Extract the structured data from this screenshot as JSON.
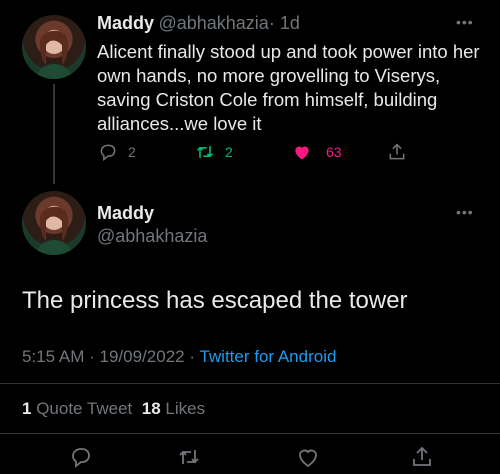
{
  "reply_tweet": {
    "author_name": "Maddy",
    "author_handle": "@abhakhazia",
    "time": "· 1d",
    "text": "Alicent finally stood up and took power into her own hands, no more grovelling to Viserys, saving Criston Cole from himself, building alliances...we love it",
    "replies": "2",
    "retweets": "2",
    "likes": "63",
    "more_icon": "more-dots-icon"
  },
  "main_tweet": {
    "author_name": "Maddy",
    "author_handle": "@abhakhazia",
    "text": "The princess has escaped the tower",
    "time": "5:15 AM",
    "date": "19/09/2022",
    "dot": "·",
    "source": "Twitter for Android",
    "quote_count": "1",
    "quote_label": "Quote Tweet",
    "likes_count": "18",
    "likes_label": "Likes"
  },
  "colors": {
    "background": "#000000",
    "text": "#e7e9ea",
    "secondary": "#71767b",
    "link": "#1d9bf0",
    "retweet": "#00ba7c",
    "like": "#f91880"
  }
}
